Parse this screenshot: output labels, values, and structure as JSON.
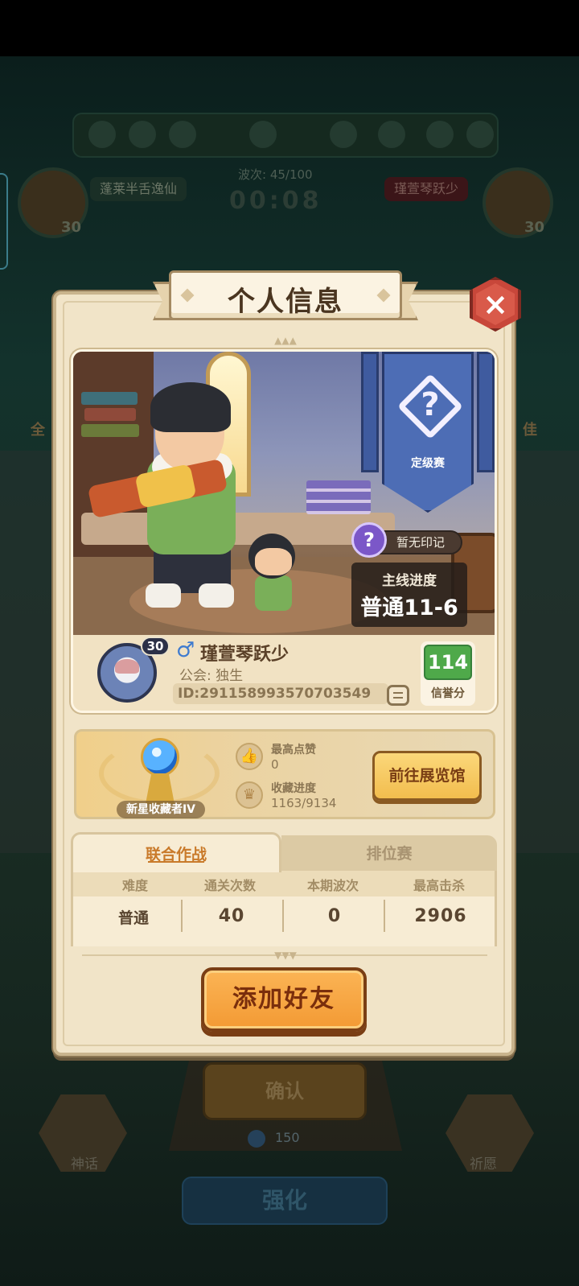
{
  "background": {
    "wave_label": "波次: 45/100",
    "timer": "00:08",
    "player_left": {
      "name": "蓬莱半舌逸仙",
      "level": "30"
    },
    "player_right": {
      "name": "瑾萱琴跃少",
      "level": "30"
    },
    "side_left_label": "全",
    "side_right_label": "佳",
    "confirm_label": "确认",
    "cost_value": "150",
    "enhance_label": "强化",
    "left_hex_label": "神话",
    "right_hex_label": "祈愿"
  },
  "modal": {
    "title": "个人信息",
    "close_icon": "×",
    "rank": {
      "icon": "?",
      "label": "定级赛"
    },
    "mark": {
      "icon": "?",
      "text": "暂无印记"
    },
    "main_progress": {
      "title": "主线进度",
      "value": "普通11-6"
    },
    "player": {
      "level": "30",
      "gender_symbol": "♂",
      "name": "瑾萱琴跃少",
      "guild": "公会: 独生",
      "id": "ID:2911589935707035​49"
    },
    "credit": {
      "score": "114",
      "label": "信誉分"
    },
    "collection": {
      "title_badge": "新星收藏者IV",
      "likes_label": "最高点赞",
      "likes_value": "0",
      "progress_label": "收藏进度",
      "progress_value": "1163/9134",
      "gallery_button": "前往展览馆"
    },
    "records": {
      "tabs": [
        "联合作战",
        "排位赛"
      ],
      "headers": [
        "难度",
        "通关次数",
        "本期波次",
        "最高击杀"
      ],
      "row": [
        "普通",
        "40",
        "0",
        "2906"
      ]
    },
    "add_friend_button": "添加好友"
  },
  "colors": {
    "accent_orange": "#f39a34",
    "credit_green": "#4fa94a",
    "close_red": "#c8473a",
    "rank_blue": "#4d6db5"
  }
}
